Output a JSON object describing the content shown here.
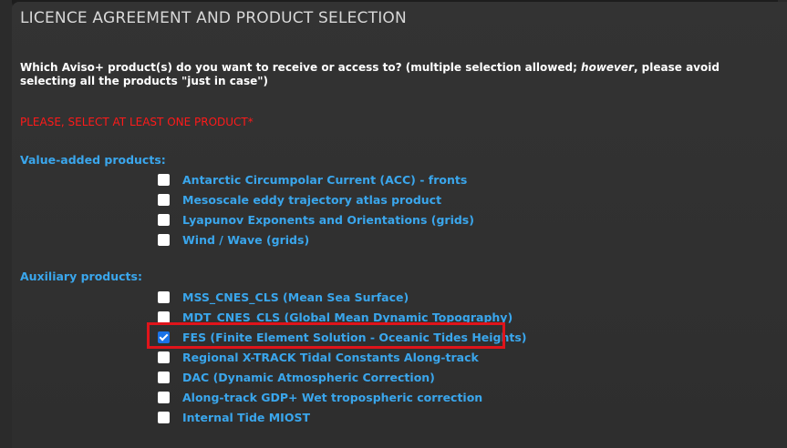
{
  "section": {
    "title": "LICENCE AGREEMENT AND PRODUCT SELECTION"
  },
  "question": {
    "text_before": "Which Aviso+ product(s) do you want to receive or access to? (multiple selection allowed; ",
    "emphasis": "however",
    "text_after": ", please avoid selecting all the products \"just in case\")"
  },
  "warning": "PLEASE, SELECT AT LEAST ONE PRODUCT*",
  "value_added": {
    "label": "Value-added products:",
    "items": [
      {
        "label": "Antarctic Circumpolar Current (ACC) - fronts",
        "checked": false
      },
      {
        "label": "Mesoscale eddy trajectory atlas product",
        "checked": false
      },
      {
        "label": "Lyapunov Exponents and Orientations (grids)",
        "checked": false
      },
      {
        "label": "Wind / Wave (grids)",
        "checked": false
      }
    ]
  },
  "auxiliary": {
    "label": "Auxiliary products:",
    "items": [
      {
        "label": "MSS_CNES_CLS (Mean Sea Surface)",
        "checked": false
      },
      {
        "label": "MDT_CNES_CLS (Global Mean Dynamic Topography)",
        "checked": false
      },
      {
        "label": "FES (Finite Element Solution - Oceanic Tides Heights)",
        "checked": true
      },
      {
        "label": "Regional X-TRACK Tidal Constants Along-track",
        "checked": false
      },
      {
        "label": "DAC (Dynamic Atmospheric Correction)",
        "checked": false
      },
      {
        "label": "Along-track GDP+ Wet tropospheric correction",
        "checked": false
      },
      {
        "label": "Internal Tide MIOST",
        "checked": false
      }
    ]
  },
  "colors": {
    "background": "#2b2b2b",
    "link_blue": "#3aa6ec",
    "warning_red": "#ff1a1a",
    "highlight_red": "#e0141b",
    "checkbox_checked": "#1a73e8"
  }
}
